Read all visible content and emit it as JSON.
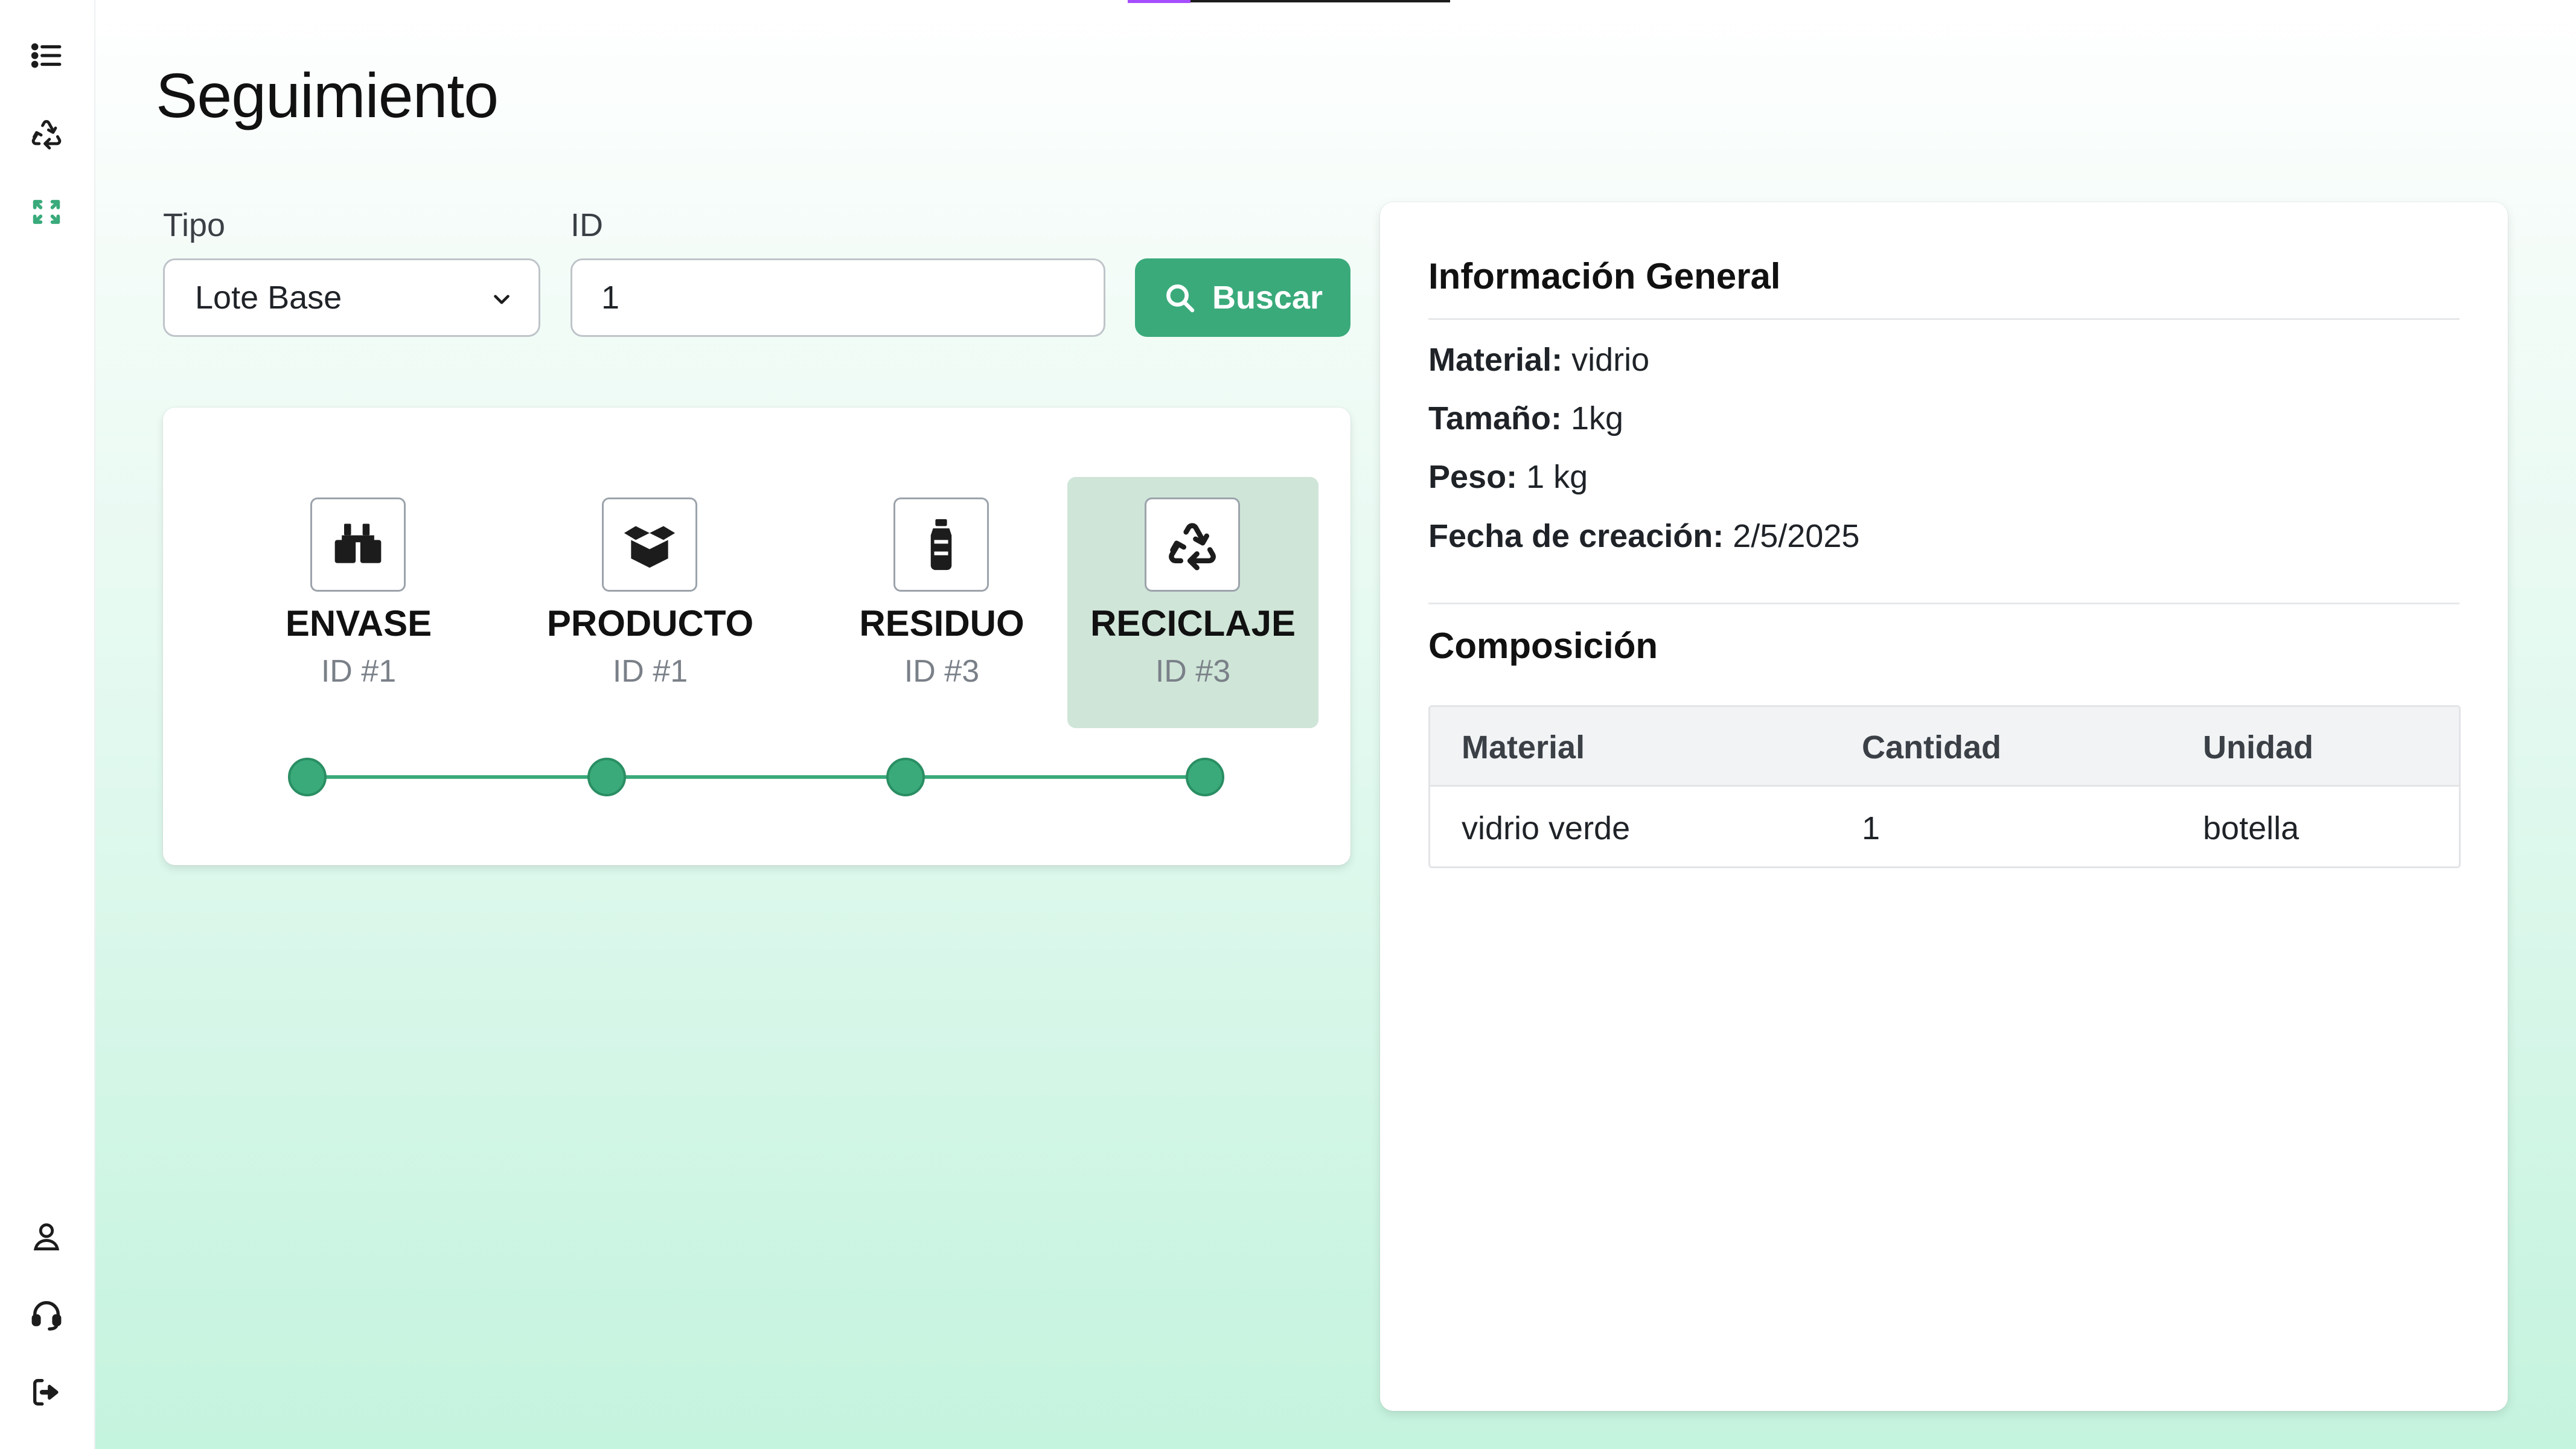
{
  "sidebar": {
    "top_icons": [
      "list-icon",
      "recycle-icon",
      "recycle-active-icon"
    ],
    "bottom_icons": [
      "user-icon",
      "headset-icon",
      "logout-icon"
    ],
    "active_color": "#3aaa7b"
  },
  "page": {
    "title": "Seguimiento"
  },
  "search": {
    "tipo_label": "Tipo",
    "tipo_value": "Lote Base",
    "id_label": "ID",
    "id_value": "1",
    "button_label": "Buscar"
  },
  "timeline": {
    "stages": [
      {
        "name": "ENVASE",
        "id": "ID #1",
        "icon": "boxes-icon",
        "active": false
      },
      {
        "name": "PRODUCTO",
        "id": "ID #1",
        "icon": "open-box-icon",
        "active": false
      },
      {
        "name": "RESIDUO",
        "id": "ID #3",
        "icon": "bottle-icon",
        "active": false
      },
      {
        "name": "RECICLAJE",
        "id": "ID #3",
        "icon": "recycle-icon",
        "active": true
      }
    ]
  },
  "info": {
    "general_title": "Información General",
    "rows": [
      {
        "key": "Material:",
        "value": " vidrio"
      },
      {
        "key": "Tamaño:",
        "value": " 1kg"
      },
      {
        "key": "Peso:",
        "value": " 1 kg"
      },
      {
        "key": "Fecha de creación:",
        "value": " 2/5/2025"
      }
    ],
    "composition_title": "Composición",
    "table": {
      "headers": [
        "Material",
        "Cantidad",
        "Unidad"
      ],
      "rows": [
        [
          "vidrio verde",
          "1",
          "botella"
        ]
      ]
    }
  },
  "colors": {
    "accent": "#3aaa7b",
    "active_stage_bg": "#cfe5d8"
  }
}
